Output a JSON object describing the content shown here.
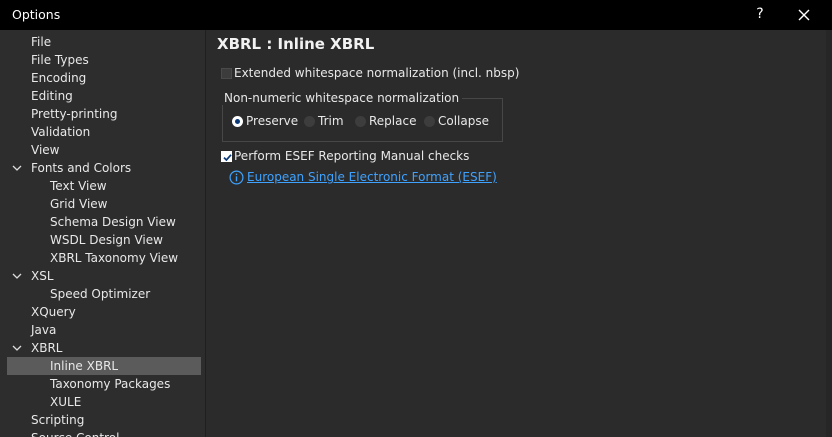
{
  "window": {
    "title": "Options",
    "help_label": "?"
  },
  "sidebar": {
    "items": [
      {
        "label": "File",
        "level": 0
      },
      {
        "label": "File Types",
        "level": 0
      },
      {
        "label": "Encoding",
        "level": 0
      },
      {
        "label": "Editing",
        "level": 0
      },
      {
        "label": "Pretty-printing",
        "level": 0
      },
      {
        "label": "Validation",
        "level": 0
      },
      {
        "label": "View",
        "level": 0
      },
      {
        "label": "Fonts and Colors",
        "level": 0,
        "expanded": true
      },
      {
        "label": "Text View",
        "level": 1
      },
      {
        "label": "Grid View",
        "level": 1
      },
      {
        "label": "Schema Design View",
        "level": 1
      },
      {
        "label": "WSDL Design View",
        "level": 1
      },
      {
        "label": "XBRL Taxonomy View",
        "level": 1
      },
      {
        "label": "XSL",
        "level": 0,
        "expanded": true
      },
      {
        "label": "Speed Optimizer",
        "level": 1
      },
      {
        "label": "XQuery",
        "level": 0
      },
      {
        "label": "Java",
        "level": 0
      },
      {
        "label": "XBRL",
        "level": 0,
        "expanded": true
      },
      {
        "label": "Inline XBRL",
        "level": 1,
        "selected": true
      },
      {
        "label": "Taxonomy Packages",
        "level": 1
      },
      {
        "label": "XULE",
        "level": 1
      },
      {
        "label": "Scripting",
        "level": 0
      },
      {
        "label": "Source Control",
        "level": 0
      }
    ]
  },
  "main": {
    "title": "XBRL : Inline XBRL",
    "extended_whitespace": {
      "label": "Extended whitespace normalization (incl. nbsp)",
      "checked": false
    },
    "whitespace_group": {
      "legend": "Non-numeric whitespace normalization",
      "options": [
        {
          "label": "Preserve",
          "selected": true
        },
        {
          "label": "Trim",
          "selected": false
        },
        {
          "label": "Replace",
          "selected": false
        },
        {
          "label": "Collapse",
          "selected": false
        }
      ]
    },
    "esef_checks": {
      "label": "Perform ESEF Reporting Manual checks",
      "checked": true
    },
    "esef_link": {
      "label": "European Single Electronic Format (ESEF)",
      "icon": "info-icon"
    }
  },
  "colors": {
    "titlebar": "#000000",
    "sidebar_bg": "#2d2d2d",
    "content_bg": "#2b2b2b",
    "selection": "#5b5b5b",
    "link": "#3fa2ff"
  }
}
